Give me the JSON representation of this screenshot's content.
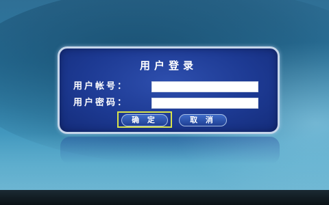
{
  "dialog": {
    "title": "用户登录",
    "username_label": "用户帐号：",
    "password_label": "用户密码：",
    "username_value": "",
    "password_value": "",
    "confirm_label": "确 定",
    "cancel_label": "取 消"
  },
  "colors": {
    "dialog_bg": "#1d3a93",
    "focus_outline": "#d9e34a",
    "background": "#2d7aa3"
  }
}
